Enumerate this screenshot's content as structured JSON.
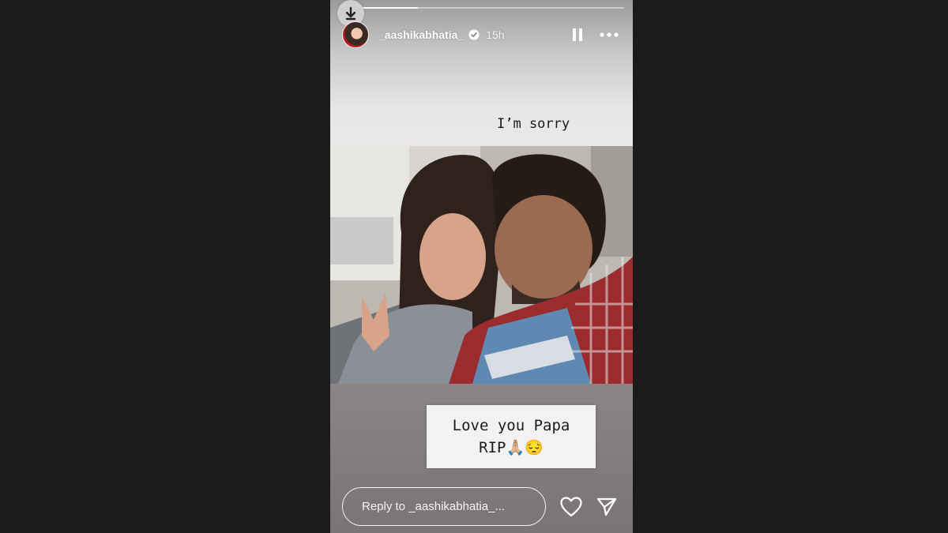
{
  "story": {
    "progress_fraction": 0.27,
    "header": {
      "username": "_aashikabhatia_",
      "verified": true,
      "time": "15h",
      "icons": [
        "download-icon",
        "pause-icon",
        "more-icon",
        "verified-badge-icon"
      ]
    },
    "caption_top": "I’m sorry",
    "caption_box": {
      "line1": "Love you Papa",
      "line2": "RIP🙏🏼😔"
    },
    "reply": {
      "placeholder": "Reply to _aashikabhatia_..."
    },
    "footer_icons": [
      "heart-icon",
      "send-icon"
    ]
  }
}
